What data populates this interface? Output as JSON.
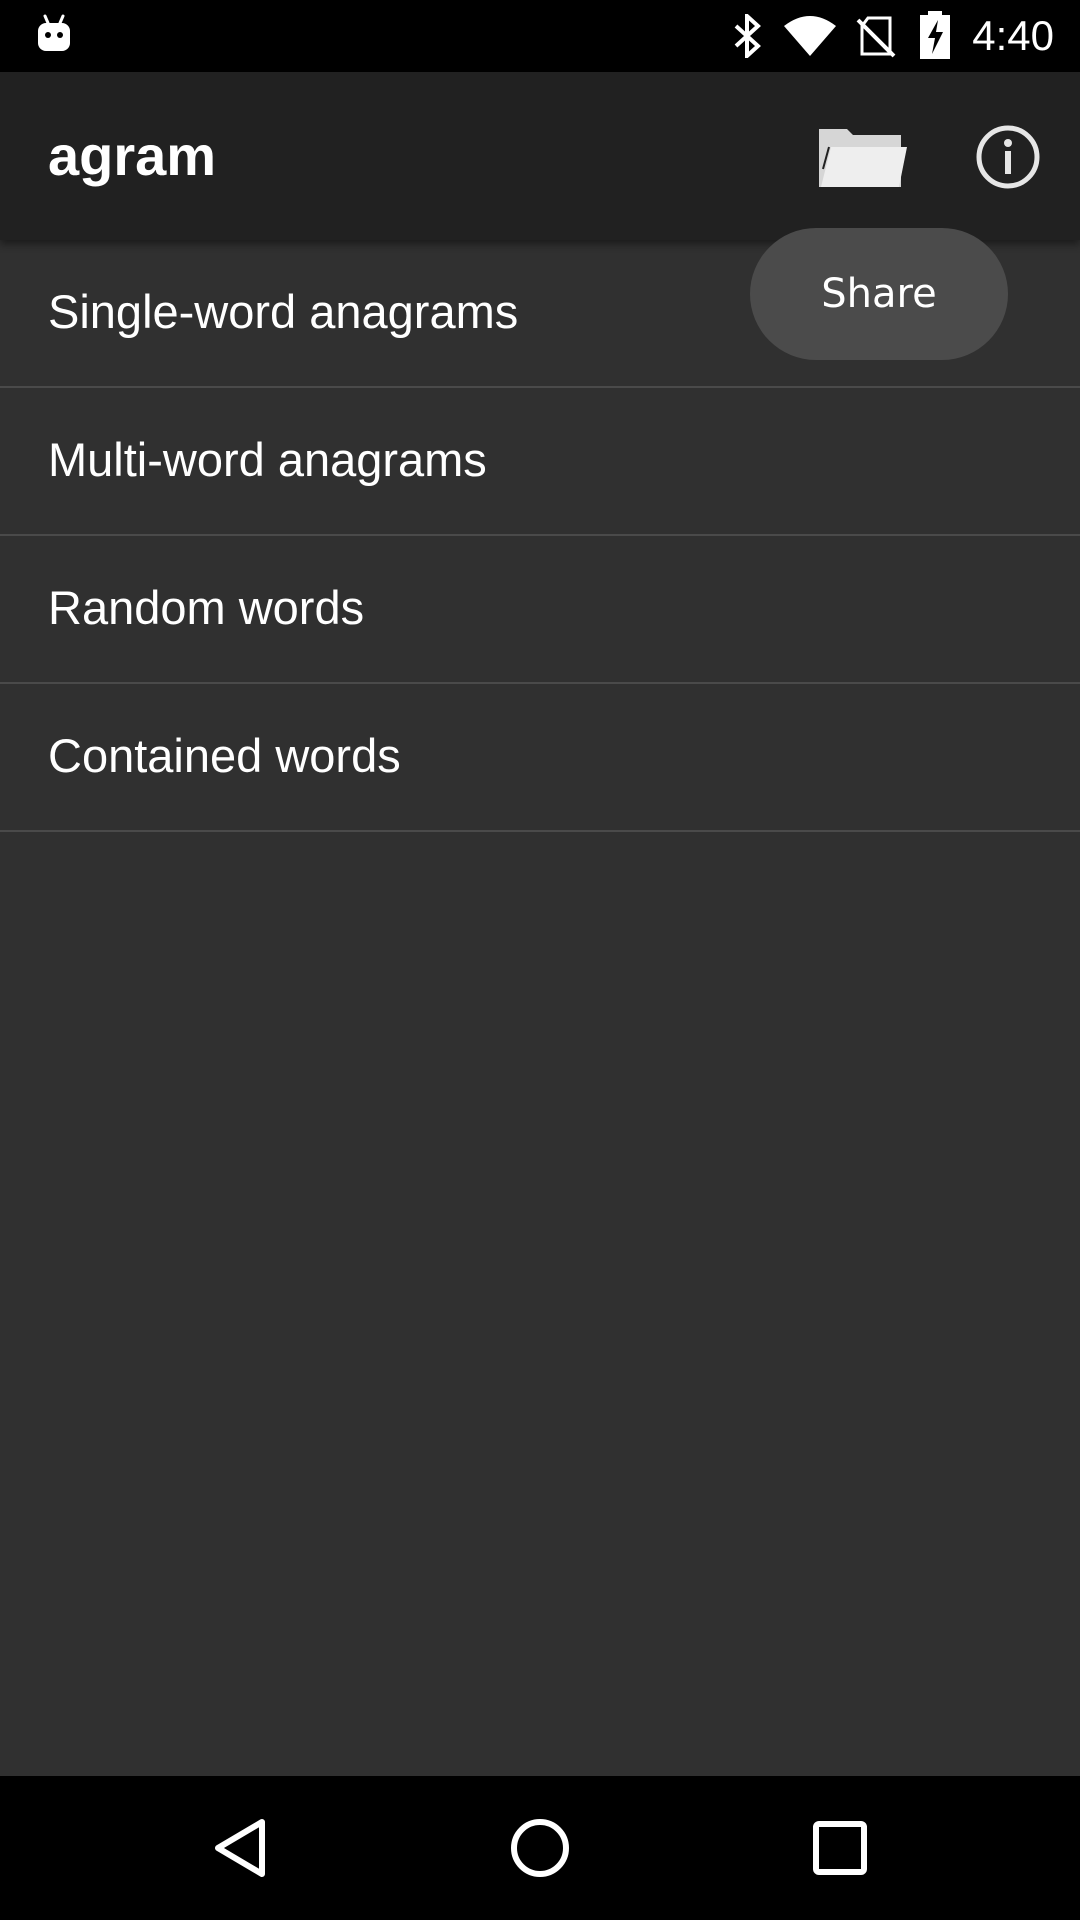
{
  "status_bar": {
    "time": "4:40",
    "icons": [
      "android-notification-icon",
      "bluetooth-icon",
      "wifi-icon",
      "no-sim-icon",
      "battery-charging-icon"
    ]
  },
  "app_bar": {
    "title": "agram",
    "actions": [
      "folder-icon",
      "info-icon"
    ]
  },
  "tooltip": {
    "label": "Share"
  },
  "menu": {
    "items": [
      {
        "label": "Single-word anagrams"
      },
      {
        "label": "Multi-word anagrams"
      },
      {
        "label": "Random words"
      },
      {
        "label": "Contained words"
      }
    ]
  },
  "nav_bar": {
    "buttons": [
      "back-icon",
      "home-icon",
      "recents-icon"
    ]
  },
  "colors": {
    "background": "#303030",
    "app_bar": "#212121",
    "tooltip": "#4b4b4b",
    "divider": "#4a4a4a",
    "text": "#ffffff"
  }
}
